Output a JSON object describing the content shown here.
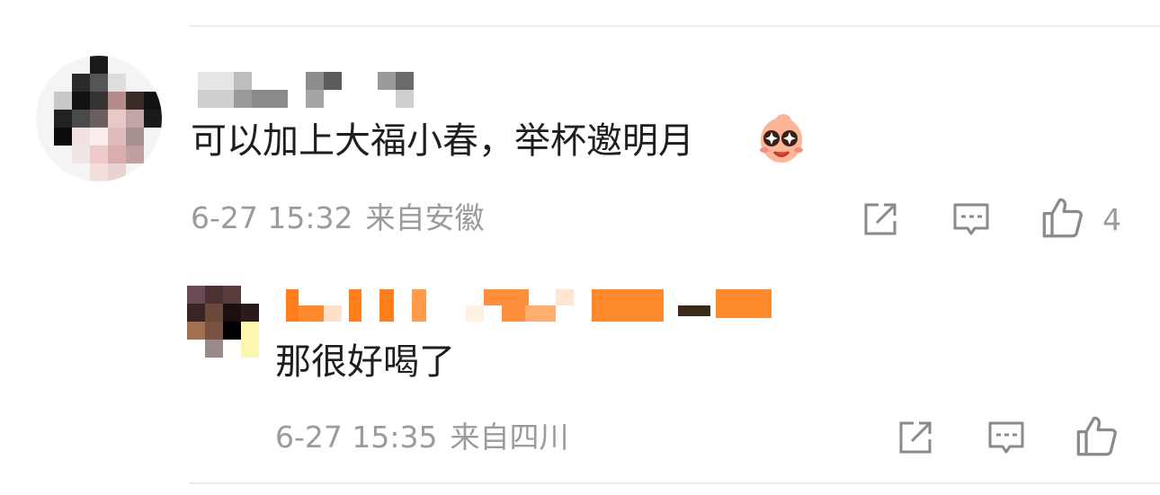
{
  "comment": {
    "text": "可以加上大福小春，举杯邀明月",
    "emoji": "emoji-icon",
    "time": "6-27 15:32",
    "location": "来自安徽",
    "actions": {
      "share_icon": "share-icon",
      "reply_icon": "comment-icon",
      "like_icon": "thumbs-up-icon",
      "like_count": "4"
    }
  },
  "reply": {
    "text": "那很好喝了",
    "time": "6-27 15:35",
    "location": "来自四川",
    "actions": {
      "share_icon": "share-icon",
      "reply_icon": "comment-icon",
      "like_icon": "thumbs-up-icon"
    }
  },
  "colors": {
    "text": "#1e1e1e",
    "meta": "#9b9b9b",
    "accent_orange": "#ff8200",
    "divider": "#ececec"
  }
}
